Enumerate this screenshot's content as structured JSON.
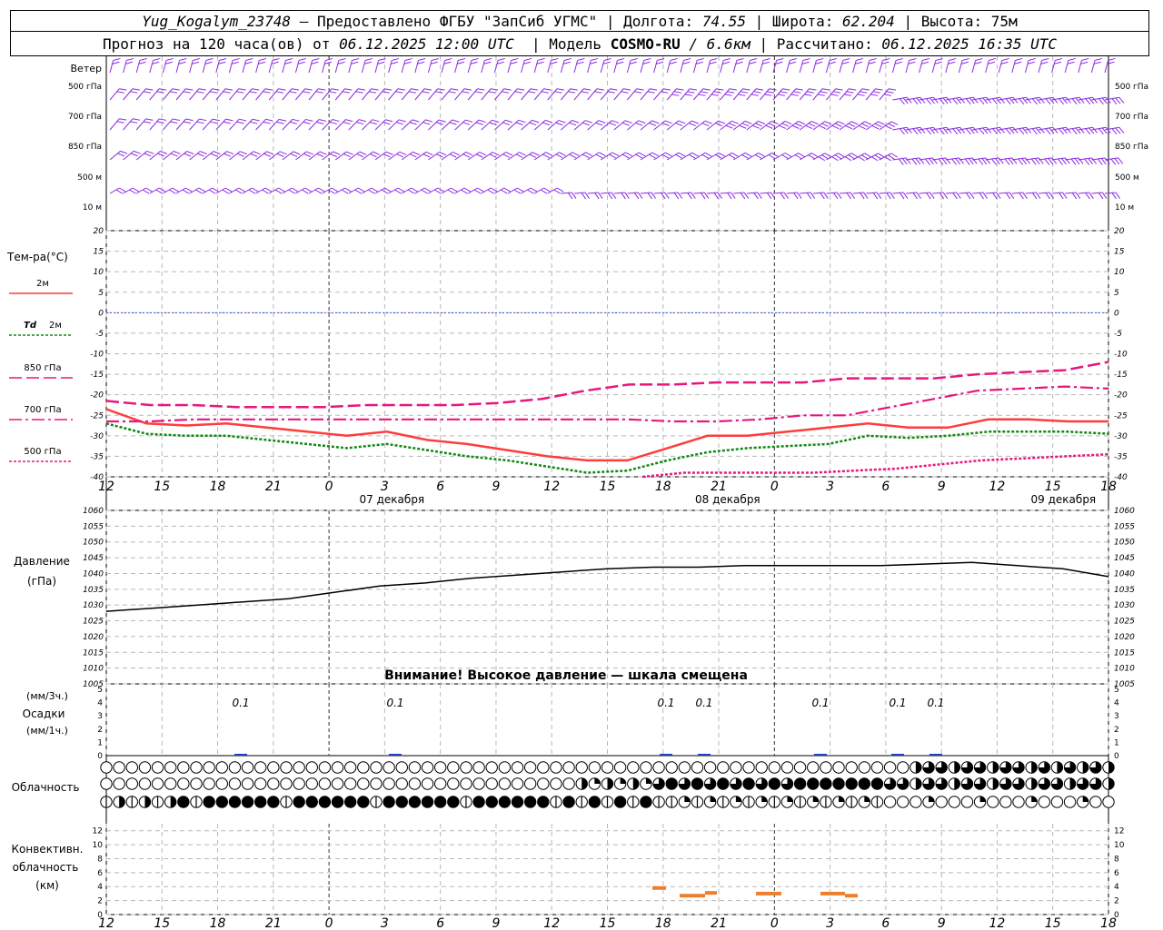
{
  "header": {
    "station": "Yug_Kogalym_23748",
    "provider": "— Предоставлено ФГБУ \"ЗапСиб УГМС\"",
    "lon_label": "Долгота:",
    "lon": "74.55",
    "lat_label": "Широта:",
    "lat": "62.204",
    "alt_label": "Высота:",
    "alt": "75м",
    "forecast_label": "Прогноз на 120 часа(ов) от",
    "forecast_time": "06.12.2025 12:00 UTC",
    "model_label": "Модель",
    "model": "COSMO-RU",
    "resolution": "/ 6.6км",
    "computed_label": "Рассчитано:",
    "computed_time": "06.12.2025 16:35 UTC",
    "sep": "|"
  },
  "wind": {
    "title": "Ветер",
    "levels": [
      "500 гПа",
      "700 гПа",
      "850 гПа",
      "500 м",
      "10  м"
    ],
    "color": "#8a2be2"
  },
  "time_axis": {
    "hour_labels": [
      "12",
      "15",
      "18",
      "21",
      "0",
      "3",
      "6",
      "9",
      "12",
      "15",
      "18",
      "21",
      "0",
      "3",
      "6",
      "9",
      "12",
      "15",
      "18"
    ],
    "day_labels": [
      "07 декабря",
      "08 декабря",
      "09 декабря"
    ]
  },
  "legend": {
    "temp_title": "Тем-ра(°С)",
    "t2m": "2м",
    "td_prefix": "Td",
    "td_suffix": "2м",
    "t850": "850 гПа",
    "t700": "700 гПа",
    "t500": "500 гПа"
  },
  "pressure": {
    "title": "Давление",
    "unit": "(гПа)",
    "warning": "Внимание! Высокое давление — шкала смещена"
  },
  "precip": {
    "unit_top": "(мм/3ч.)",
    "title": "Осадки",
    "unit_bottom": "(мм/1ч.)",
    "labels": [
      "0.1",
      "0.1",
      "0.1",
      "0.1",
      "0.1",
      "0.1",
      "0.1"
    ]
  },
  "cloud": {
    "title": "Облачность"
  },
  "convective": {
    "title1": "Конвективн.",
    "title2": "облачность",
    "unit": "(км)"
  },
  "colors": {
    "t2m": "#ff3c3c",
    "td": "#118811",
    "t850": "#e8167f",
    "t700": "#e8167f",
    "t500": "#e8167f",
    "pressure": "#000000",
    "precip": "#1f3fbf",
    "convective": "#ee7f2d",
    "zero_line": "#3a4fd6"
  },
  "chart_data": [
    {
      "type": "line",
      "title": "Тем-ра(°С)",
      "x": [
        "12",
        "15",
        "18",
        "21",
        "0",
        "3",
        "6",
        "9",
        "12",
        "15",
        "18",
        "21",
        "0",
        "3",
        "6",
        "9",
        "12",
        "15",
        "18"
      ],
      "ylim": [
        -40,
        20
      ],
      "series": [
        {
          "name": "2м",
          "values": [
            -23.5,
            -27,
            -27.5,
            -27,
            -28,
            -29,
            -30,
            -29,
            -31,
            -32,
            -33.5,
            -35,
            -36,
            -36,
            -33,
            -30,
            -30,
            -29,
            -28,
            -27,
            -28,
            -28,
            -26,
            -26,
            -26.5,
            -26.5
          ]
        },
        {
          "name": "Td 2м",
          "values": [
            -27,
            -29.5,
            -30,
            -30,
            -31,
            -32,
            -33,
            -32,
            -33.5,
            -35,
            -36,
            -37.5,
            -39,
            -38.5,
            -36,
            -34,
            -33,
            -32.5,
            -32,
            -30,
            -30.5,
            -30,
            -29,
            -29,
            -29,
            -29.5
          ]
        },
        {
          "name": "850 гПа",
          "values": [
            -21.5,
            -22.5,
            -22.5,
            -23,
            -23,
            -23,
            -22.5,
            -22.5,
            -22.5,
            -22,
            -21,
            -19,
            -17.5,
            -17.5,
            -17,
            -17,
            -17,
            -16,
            -16,
            -16,
            -15,
            -14.5,
            -14,
            -12
          ]
        },
        {
          "name": "700 гПа",
          "values": [
            -26.5,
            -26.5,
            -26,
            -26,
            -26,
            -26,
            -26,
            -26,
            -26,
            -26,
            -26,
            -26,
            -26,
            -26.5,
            -26.5,
            -26,
            -25,
            -25,
            -23,
            -21,
            -19,
            -18.5,
            -18,
            -18.5
          ]
        },
        {
          "name": "500 гПа",
          "values": [
            -40,
            -39,
            -39,
            -39,
            -39,
            -38.5,
            -38,
            -37,
            -36,
            -35.5,
            -35,
            -34.5
          ]
        }
      ]
    },
    {
      "type": "line",
      "title": "Давление",
      "x": [
        "12",
        "15",
        "18",
        "21",
        "0",
        "3",
        "6",
        "9",
        "12",
        "15",
        "18",
        "21",
        "0",
        "3",
        "6",
        "9",
        "12",
        "15",
        "18"
      ],
      "ylim": [
        1005,
        1060
      ],
      "series": [
        {
          "name": "Давление",
          "values": [
            1028,
            1029,
            1030,
            1031,
            1032,
            1034,
            1036,
            1037,
            1038.5,
            1039.5,
            1040.5,
            1041.5,
            1042,
            1042,
            1042.5,
            1042.5,
            1042.5,
            1042.5,
            1043,
            1043.5,
            1042.5,
            1041.5,
            1039
          ]
        }
      ]
    },
    {
      "type": "bar",
      "title": "Осадки",
      "x": [
        "21",
        "9",
        "6",
        "9",
        "21",
        "0",
        "3"
      ],
      "ylim": [
        0,
        5
      ],
      "values": [
        0.1,
        0.1,
        0.1,
        0.1,
        0.1,
        0.1,
        0.1
      ]
    },
    {
      "type": "bar",
      "title": "Конвективн. облачность",
      "ylim": [
        0,
        13
      ],
      "values": [
        3.8,
        2.7,
        3.1,
        3.0,
        3.0,
        2.7
      ]
    }
  ]
}
